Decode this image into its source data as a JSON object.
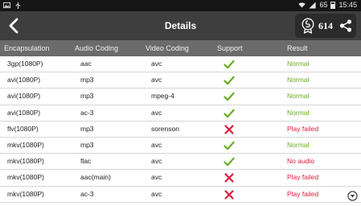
{
  "status_bar": {
    "signal": "65",
    "time": "15:45"
  },
  "header": {
    "title": "Details",
    "credits": "614"
  },
  "columns": [
    "Encapsulation",
    "Audio Coding",
    "Video Coding",
    "Support",
    "Result"
  ],
  "rows": [
    {
      "encapsulation": "3gp(1080P)",
      "audio": "aac",
      "video": "avc",
      "support": "yes",
      "result": "Normal"
    },
    {
      "encapsulation": "avi(1080P)",
      "audio": "mp3",
      "video": "avc",
      "support": "yes",
      "result": "Normal"
    },
    {
      "encapsulation": "avi(1080P)",
      "audio": "mp3",
      "video": "mpeg-4",
      "support": "yes",
      "result": "Normal"
    },
    {
      "encapsulation": "avi(1080P)",
      "audio": "ac-3",
      "video": "avc",
      "support": "yes",
      "result": "Normal"
    },
    {
      "encapsulation": "flv(1080P)",
      "audio": "mp3",
      "video": "sorenson",
      "support": "no",
      "result": "Play failed"
    },
    {
      "encapsulation": "mkv(1080P)",
      "audio": "mp3",
      "video": "avc",
      "support": "yes",
      "result": "Normal"
    },
    {
      "encapsulation": "mkv(1080P)",
      "audio": "flac",
      "video": "avc",
      "support": "yes",
      "result": "No audio"
    },
    {
      "encapsulation": "mkv(1080P)",
      "audio": "aac(main)",
      "video": "avc",
      "support": "no",
      "result": "Play failed"
    },
    {
      "encapsulation": "mkv(1080P)",
      "audio": "ac-3",
      "video": "avc",
      "support": "no",
      "result": "Play failed"
    }
  ],
  "colors": {
    "normal": "#6aaa1f",
    "failed": "#e01a3a",
    "header_bg": "#3e3e3e",
    "column_bg": "#6b6b6b"
  },
  "icons": {
    "back": "chevron-left-icon",
    "credits": "medal-icon",
    "share": "share-icon",
    "supported": "check-icon",
    "unsupported": "cross-icon",
    "scroll": "scroll-down-icon"
  }
}
